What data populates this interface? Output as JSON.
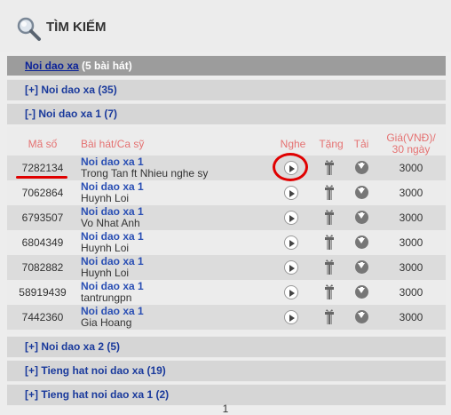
{
  "header": {
    "title": "TÌM KIẾM",
    "icon": "search-icon"
  },
  "top_bar": {
    "link": "Noi dao xa",
    "count": "(5 bài hát)"
  },
  "groups": {
    "g1": "[+] Noi dao xa (35)",
    "g2": "[-] Noi dao xa 1 (7)",
    "g3": "[+] Noi dao xa 2 (5)",
    "g4": "[+] Tieng hat noi dao xa (19)",
    "g5": "[+] Tieng hat noi dao xa 1 (2)"
  },
  "table": {
    "headers": {
      "code": "Mã số",
      "song": "Bài hát/Ca sỹ",
      "listen": "Nghe",
      "gift": "Tặng",
      "download": "Tải",
      "price_line1": "Giá(VNĐ)/",
      "price_line2": "30 ngày"
    },
    "rows": [
      {
        "code": "7282134",
        "song": "Noi dao xa 1",
        "artist": "Trong Tan ft Nhieu nghe sy",
        "price": "3000"
      },
      {
        "code": "7062864",
        "song": "Noi dao xa 1",
        "artist": "Huynh Loi",
        "price": "3000"
      },
      {
        "code": "6793507",
        "song": "Noi dao xa 1",
        "artist": "Vo Nhat Anh",
        "price": "3000"
      },
      {
        "code": "6804349",
        "song": "Noi dao xa 1",
        "artist": "Huynh Loi",
        "price": "3000"
      },
      {
        "code": "7082882",
        "song": "Noi dao xa 1",
        "artist": "Huynh Loi",
        "price": "3000"
      },
      {
        "code": "58919439",
        "song": "Noi dao xa 1",
        "artist": "tantrungpn",
        "price": "3000"
      },
      {
        "code": "7442360",
        "song": "Noi dao xa 1",
        "artist": "Gia Hoang",
        "price": "3000"
      }
    ]
  },
  "pager": {
    "current": "1"
  },
  "colors": {
    "header_text": "#e57272",
    "link": "#1a3a9c",
    "annotation": "#e00000"
  }
}
